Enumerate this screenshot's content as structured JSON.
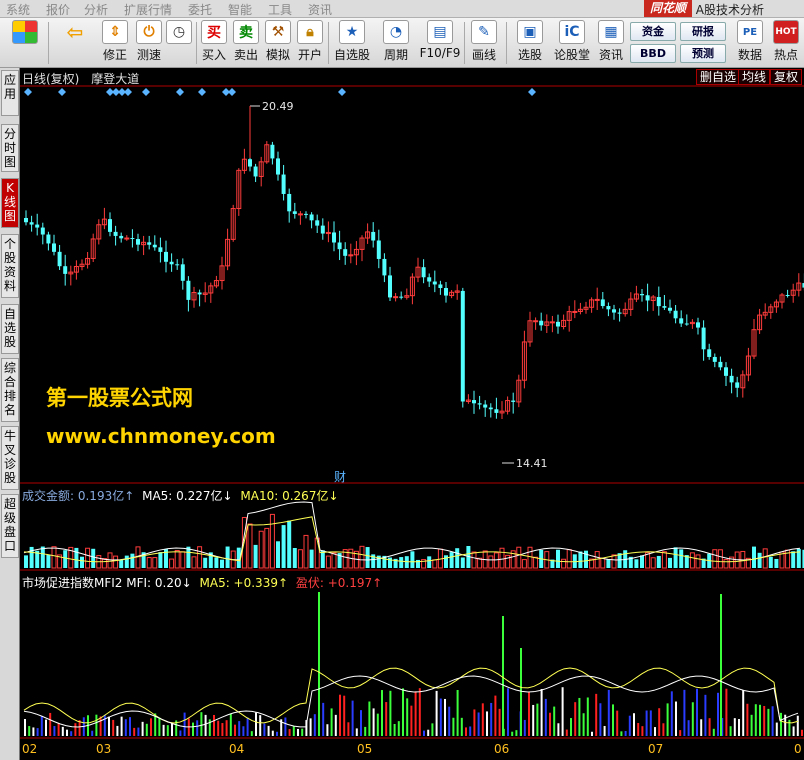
{
  "menu": {
    "items": [
      "系统",
      "报价",
      "分析",
      "扩展行情",
      "委托",
      "智能",
      "工具",
      "资讯"
    ],
    "brand": "同花顺",
    "brand_sub": "A股技术分析"
  },
  "toolbar": {
    "buttons": [
      {
        "label": "",
        "icon": "grid-icon"
      },
      {
        "label": "",
        "icon": "back-arrow-icon"
      },
      {
        "label": "修正",
        "icon": "arrows-icon"
      },
      {
        "label": "测速",
        "icon": "clock-icon"
      },
      {
        "label": "买入",
        "icon": "买"
      },
      {
        "label": "卖出",
        "icon": "卖"
      },
      {
        "label": "模拟",
        "icon": "hammer-icon"
      },
      {
        "label": "开户",
        "icon": "lock-icon"
      },
      {
        "label": "自选股",
        "icon": "star-icon"
      },
      {
        "label": "周期",
        "icon": "cycle-icon"
      },
      {
        "label": "F10/F9",
        "icon": "f10-icon"
      },
      {
        "label": "画线",
        "icon": "pen-icon"
      },
      {
        "label": "选股",
        "icon": "monitor-icon"
      },
      {
        "label": "论股堂",
        "icon": "forum-icon"
      },
      {
        "label": "资讯",
        "icon": "news-icon"
      },
      {
        "label": "数据",
        "icon": "PE"
      },
      {
        "label": "热点",
        "icon": "HOT"
      }
    ],
    "mini": {
      "zijin": "资金",
      "yanbao": "研报",
      "bbd": "BBD",
      "yuce": "预测"
    }
  },
  "lefttabs": [
    "应用",
    "分时图",
    "K线图",
    "个股资料",
    "自选股",
    "综合排名",
    "牛叉诊股",
    "超级盘口"
  ],
  "header": {
    "period": "日线(复权)",
    "name": "摩登大道",
    "btn_del": "删自选",
    "btn_ma": "均线",
    "btn_fq": "复权"
  },
  "price": {
    "high": "20.49",
    "low": "14.41",
    "cai": "财"
  },
  "watermark": {
    "line1": "第一股票公式网",
    "line2": "www.chnmoney.com"
  },
  "volume": {
    "label": "成交金额: 0.193亿↑",
    "ma5": "MA5: 0.227亿↓",
    "ma10": "MA10: 0.267亿↓"
  },
  "mfi": {
    "label": "市场促进指数MFI2 MFI: 0.20↓",
    "ma5": "MA5: +0.339↑",
    "yk": "盈伏: +0.197↑"
  },
  "xaxis": [
    "02",
    "03",
    "04",
    "05",
    "06",
    "07",
    "0"
  ],
  "colors": {
    "up": "#ff3c3c",
    "down": "#54ffff",
    "ma_white": "#ffffff",
    "ma_yellow": "#ffff54",
    "mfi_green": "#3cff3c",
    "mfi_blue": "#2a3cff",
    "mfi_red": "#ff2020"
  }
}
